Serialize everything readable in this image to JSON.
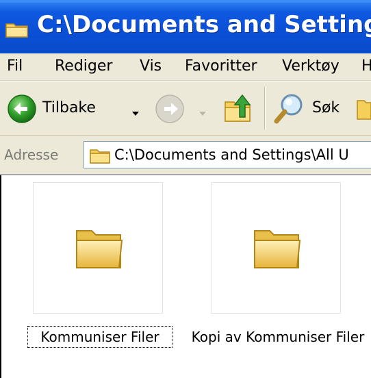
{
  "window": {
    "title": "C:\\Documents and Settings\\"
  },
  "menu": {
    "items": [
      "Fil",
      "Rediger",
      "Vis",
      "Favoritter",
      "Verktøy",
      "H"
    ]
  },
  "toolbar": {
    "back_label": "Tilbake",
    "search_label": "Søk"
  },
  "address": {
    "label": "Adresse",
    "value": "C:\\Documents and Settings\\All U"
  },
  "files": [
    {
      "name": "Kommuniser Filer",
      "selected": true
    },
    {
      "name": "Kopi av Kommuniser Filer",
      "selected": false
    }
  ],
  "colors": {
    "titlebar": "#0a4fd6",
    "chrome": "#ece9d8",
    "folder": "#f2c94c",
    "back_green": "#2f9e2a"
  }
}
